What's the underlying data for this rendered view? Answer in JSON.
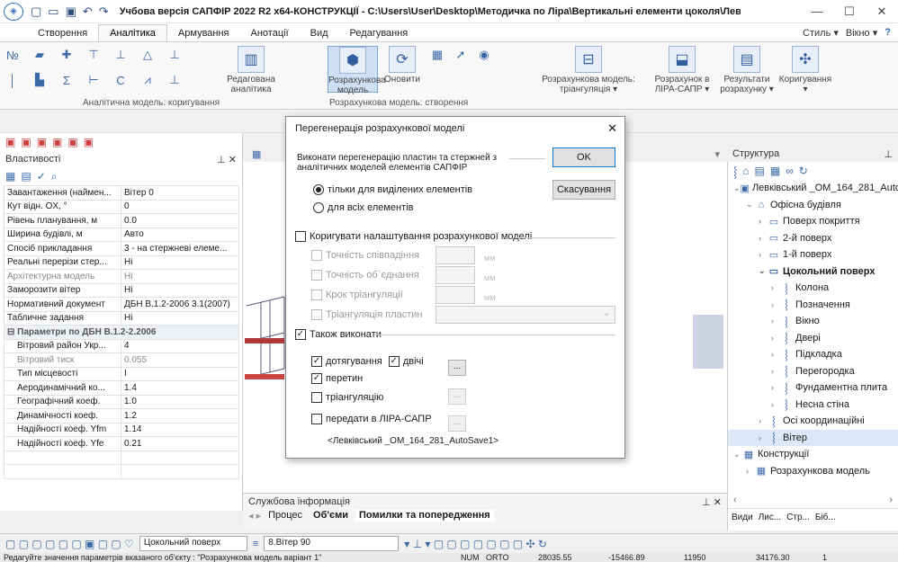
{
  "window": {
    "title": "Учбова версія САПФІР 2022 R2 x64-КОНСТРУКЦІЇ - C:\\Users\\User\\Desktop\\Методичка по Ліра\\Вертикальні елементи цоколя\\Левківськ...",
    "min": "—",
    "max": "☐",
    "close": "✕"
  },
  "ribbon_tabs": [
    "Створення",
    "Аналітика",
    "Армування",
    "Анотації",
    "Вид",
    "Редагування"
  ],
  "ribbon_right": {
    "style": "Стиль ▾",
    "window": "Вікно ▾",
    "help": "?"
  },
  "ribbon": {
    "edit_analytics": "Редагована аналітика",
    "calc_model": "Розрахункова модель",
    "update": "Оновити",
    "calc_model_tri": "Розрахункова модель: тріангуляція ▾",
    "calc_lira": "Розрахунок в ЛІРА-САПР ▾",
    "results": "Результати розрахунку ▾",
    "corrections": "Коригування ▾",
    "group_left": "Аналітична модель: коригування",
    "group_mid": "Розрахункова модель: створення"
  },
  "props": {
    "title": "Властивості",
    "rows": [
      {
        "n": "Завантаження (наймен...",
        "v": "Вітер 0"
      },
      {
        "n": "Кут відн. OX, °",
        "v": "0"
      },
      {
        "n": "Рівень планування, м",
        "v": "0.0"
      },
      {
        "n": "Ширина будівлі, м",
        "v": "Авто"
      },
      {
        "n": "Спосіб прикладання",
        "v": "3 - на стержневі елеме..."
      },
      {
        "n": "Реальні перерізи стер...",
        "v": "Ні"
      },
      {
        "n": "Архітектурна модель",
        "v": "Ні"
      },
      {
        "n": "Заморозити вітер",
        "v": "Ні"
      },
      {
        "n": "Нормативний документ",
        "v": "ДБН В.1.2-2006 3.1(2007)"
      },
      {
        "n": "Табличне задання",
        "v": "Ні"
      }
    ],
    "section": "⊟  Параметри по ДБН В.1.2-2.2006",
    "subrows": [
      {
        "n": "Вітровий район Укр...",
        "v": "4"
      },
      {
        "n": "Вітровий тиск",
        "v": "0.055"
      },
      {
        "n": "Тип місцевості",
        "v": "I"
      },
      {
        "n": "Аеродинамічний ко...",
        "v": "1.4"
      },
      {
        "n": "Географічний коеф.",
        "v": "1.0"
      },
      {
        "n": "Динамічності коеф.",
        "v": "1.2"
      },
      {
        "n": "Надійності коеф. Yfm",
        "v": "1.14"
      },
      {
        "n": "Надійності коеф. Yfe",
        "v": "0.21"
      }
    ]
  },
  "structure": {
    "title": "Структура",
    "items": [
      {
        "t": "Левківський _ОМ_164_281_Auto",
        "lvl": 0,
        "exp": "⌄",
        "icon": "building-file-icon",
        "glyph": "▣"
      },
      {
        "t": "Офісна будівля",
        "lvl": 1,
        "exp": "⌄",
        "icon": "house-icon",
        "glyph": "⌂"
      },
      {
        "t": "Поверх покриття",
        "lvl": 2,
        "exp": "›",
        "icon": "storey-icon",
        "glyph": "▭"
      },
      {
        "t": "2-й поверх",
        "lvl": 2,
        "exp": "›",
        "icon": "storey-icon",
        "glyph": "▭"
      },
      {
        "t": "1-й поверх",
        "lvl": 2,
        "exp": "›",
        "icon": "storey-icon",
        "glyph": "▭"
      },
      {
        "t": "Цокольний поверх",
        "lvl": 2,
        "exp": "⌄",
        "icon": "storey-icon",
        "glyph": "▭",
        "bold": true
      },
      {
        "t": "Колона",
        "lvl": 3,
        "exp": "›",
        "icon": "group-icon",
        "glyph": "⸾"
      },
      {
        "t": "Позначення",
        "lvl": 3,
        "exp": "›",
        "icon": "group-icon",
        "glyph": "⸾"
      },
      {
        "t": "Вікно",
        "lvl": 3,
        "exp": "›",
        "icon": "group-icon",
        "glyph": "⸾"
      },
      {
        "t": "Двері",
        "lvl": 3,
        "exp": "›",
        "icon": "group-icon",
        "glyph": "⸾"
      },
      {
        "t": "Підкладка",
        "lvl": 3,
        "exp": "›",
        "icon": "group-icon",
        "glyph": "⸾"
      },
      {
        "t": "Перегородка",
        "lvl": 3,
        "exp": "›",
        "icon": "group-icon",
        "glyph": "⸾"
      },
      {
        "t": "Фундаментна плита",
        "lvl": 3,
        "exp": "›",
        "icon": "group-icon",
        "glyph": "⸾"
      },
      {
        "t": "Несна стіна",
        "lvl": 3,
        "exp": "›",
        "icon": "group-icon",
        "glyph": "⸾"
      },
      {
        "t": "Осі координаційні",
        "lvl": 2,
        "exp": "›",
        "icon": "group-icon",
        "glyph": "⸾"
      },
      {
        "t": "Вітер",
        "lvl": 2,
        "exp": "›",
        "icon": "group-icon",
        "glyph": "⸾",
        "sel": true
      },
      {
        "t": "Конструкції",
        "lvl": 0,
        "exp": "⌄",
        "icon": "structure-icon",
        "glyph": "▦"
      },
      {
        "t": "Розрахункова модель",
        "lvl": 1,
        "exp": "›",
        "icon": "structure-icon",
        "glyph": "▦"
      }
    ],
    "bottom_tabs": [
      "Види",
      "Лис...",
      "Стр...",
      "Біб..."
    ]
  },
  "service": {
    "title": "Службова інформація",
    "tabs": [
      "Процес",
      "Об'єми",
      "Помилки та попередження"
    ]
  },
  "bottom": {
    "level": "Цокольний поверх",
    "wind": "8.Вітер 90",
    "status": "Редагуйте значення параметрів вказаного об'єкту : \"Розрахункова модель варіант 1\"",
    "num": "NUM",
    "ortho": "ORTO",
    "c1": "28035.55",
    "c2": "-15466.89",
    "c3": "11950",
    "c4": "34176.30",
    "c5": "1"
  },
  "dialog": {
    "title": "Перегенерація розрахункової моделі",
    "intro": "Виконати перегенерацію пластин та стержней з аналітичних моделей елементів САПФІР",
    "ok": "OK",
    "cancel": "Скасування",
    "radio_selected": "тільки для виділених елементів",
    "radio_all": "для всіх елементів",
    "adjust_label": "Коригувати налаштування розрахункової моделі",
    "opt1": "Точність співпадіння",
    "opt2": "Точність об`єднання",
    "opt3": "Крок тріангуляції",
    "opt4": "Тріангуляція пластин",
    "unit": "мм",
    "also_label": "Також виконати",
    "chk_pull": "дотягування",
    "chk_twice": "двічі",
    "chk_cross": "перетин",
    "chk_tri": "тріангуляцію",
    "chk_lira": "передати в ЛІРА-САПР",
    "file": "<Левківський _ОМ_164_281_AutoSave1>"
  }
}
